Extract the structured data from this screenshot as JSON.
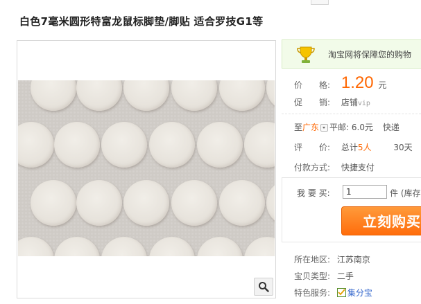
{
  "product": {
    "title": "白色7毫米圆形特富龙鼠标脚垫/脚贴 适合罗技G1等"
  },
  "banner": {
    "text": "淘宝网将保障您的购物",
    "icon": "trophy-icon"
  },
  "price": {
    "label": "价　　格:",
    "value": "1.20",
    "unit": "元"
  },
  "promo": {
    "label": "促　　销:",
    "value": "店铺",
    "badge": "vip"
  },
  "shipping": {
    "prefix": "至",
    "location": "广东",
    "fee": "平邮: 6.0元",
    "express": "快递"
  },
  "rating": {
    "label": "评　　价:",
    "total_prefix": "总计",
    "count": "5人",
    "trailing": "30天"
  },
  "payment": {
    "label": "付款方式:",
    "value": "快捷支付"
  },
  "buy": {
    "qty_label": "我 要 买:",
    "qty_value": "1",
    "stock": "件 (库存",
    "button": "立刻购买"
  },
  "details": {
    "location_label": "所在地区:",
    "location": "江苏南京",
    "type_label": "宝贝类型:",
    "type": "二手",
    "service_label": "特色服务:",
    "service": "集分宝"
  },
  "colors": {
    "accent": "#ff6600",
    "link": "#3366cc",
    "banner_bg": "#f2fbe9"
  }
}
